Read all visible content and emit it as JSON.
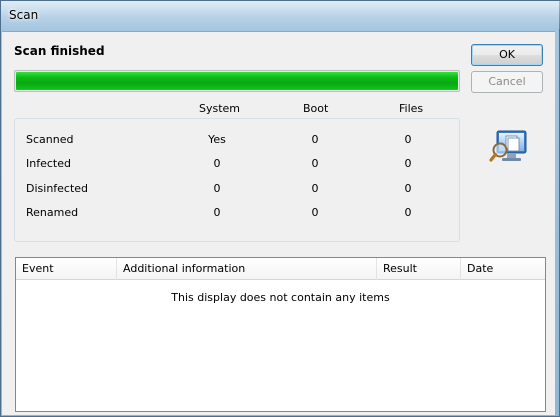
{
  "window": {
    "title": "Scan"
  },
  "status": {
    "heading": "Scan finished",
    "progress_fraction": 1.0
  },
  "buttons": {
    "ok": "OK",
    "cancel": "Cancel"
  },
  "stats": {
    "columns": [
      "System",
      "Boot",
      "Files"
    ],
    "rows": [
      {
        "label": "Scanned",
        "values": [
          "Yes",
          "0",
          "0"
        ]
      },
      {
        "label": "Infected",
        "values": [
          "0",
          "0",
          "0"
        ]
      },
      {
        "label": "Disinfected",
        "values": [
          "0",
          "0",
          "0"
        ]
      },
      {
        "label": "Renamed",
        "values": [
          "0",
          "0",
          "0"
        ]
      }
    ]
  },
  "events": {
    "columns": [
      "Event",
      "Additional information",
      "Result",
      "Date"
    ],
    "empty_text": "This display does not contain any items"
  },
  "icons": {
    "scan": "computer-magnifier-icon"
  },
  "colors": {
    "progress": "#0fb919",
    "accent": "#3c7fb1"
  }
}
